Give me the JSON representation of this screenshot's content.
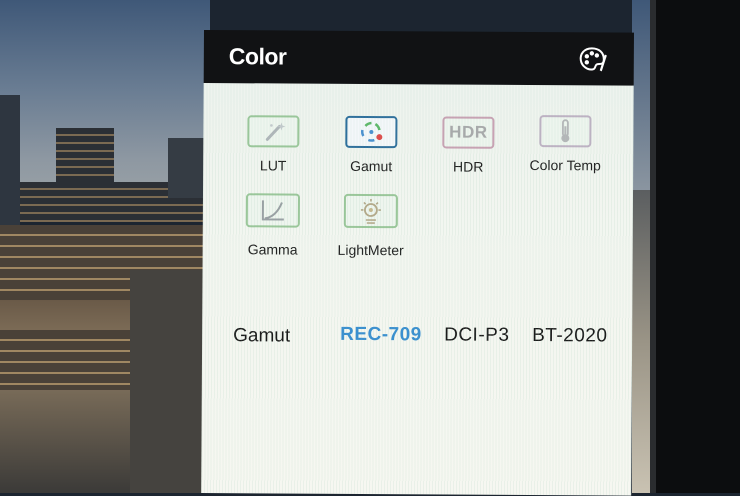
{
  "panel": {
    "title": "Color",
    "header_icon": "palette-icon"
  },
  "tiles": [
    {
      "label": "LUT",
      "icon": "magic-wand-icon"
    },
    {
      "label": "Gamut",
      "icon": "color-wheel-icon",
      "selected": true
    },
    {
      "label": "HDR",
      "icon": "hdr-icon",
      "icon_text": "HDR"
    },
    {
      "label": "Color Temp",
      "icon": "thermometer-icon"
    },
    {
      "label": "Gamma",
      "icon": "gamma-curve-icon"
    },
    {
      "label": "LightMeter",
      "icon": "light-meter-icon"
    }
  ],
  "gamut_row": {
    "label": "Gamut",
    "options": [
      "REC-709",
      "DCI-P3",
      "BT-2020"
    ],
    "selected": "REC-709"
  },
  "colors": {
    "header_bg": "#111214",
    "selected_option": "#3a8fd0",
    "tile_border": "#9bc79a",
    "selected_tile_border": "#2e6f9c"
  }
}
